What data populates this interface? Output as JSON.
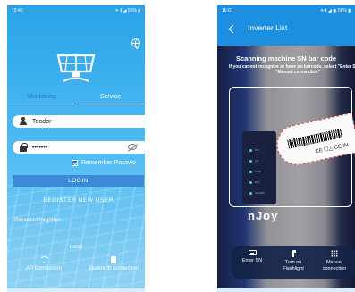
{
  "left_screen": {
    "status_bar": {
      "time": "15:40",
      "indicators": "✳ ℹ ◢ 56% ▮"
    },
    "icons": {
      "language": "globe-icon",
      "logo": "solar-panel-logo-icon"
    },
    "tabs": [
      {
        "label": "Monitoring",
        "active": true
      },
      {
        "label": "Service",
        "active": false
      }
    ],
    "username": {
      "value": "Teodor",
      "icon": "user-icon"
    },
    "password": {
      "value": "•••••••",
      "icon": "lock-icon",
      "toggle_icon": "eye-off-icon"
    },
    "remember": {
      "label": "Remember Passwo",
      "checked": true
    },
    "login_label": "LOGIN",
    "register_label": "REGISTER NEW USER",
    "forgot_label": "Password forgotten",
    "local_label": "Local",
    "connections": [
      {
        "label": "AP Connection",
        "icon": "wifi-icon"
      },
      {
        "label": "Bluetooth connection",
        "icon": "bluetooth-icon"
      }
    ],
    "colors": {
      "accent": "#3a8ad8",
      "background_top": "#2aa3e8"
    }
  },
  "right_screen": {
    "status_bar": {
      "time": "16:01",
      "indicators": "✳ ℹ ◢ ◉ 58% ▮"
    },
    "nav": {
      "title": "Inverter List",
      "back_icon": "back-arrow-icon"
    },
    "scan": {
      "title": "Scanning machine SN bar code",
      "hint": "If you cannot recognize or have no barcode, select \"Enter SN\" or \"Manual connection\""
    },
    "device_brand": "nJoy",
    "sticker_marks": "CE ☐△ CE IN",
    "device_leds": [
      "PV",
      "AC",
      "COM",
      "BAT",
      "ALARM"
    ],
    "tools": [
      {
        "label": "Enter SN",
        "icon": "keyboard-icon"
      },
      {
        "label": "Turn on Flashlight",
        "icon": "flashlight-icon"
      },
      {
        "label": "Manual connection",
        "icon": "grid-menu-icon"
      }
    ],
    "colors": {
      "nav": "#1d8fe0"
    }
  }
}
